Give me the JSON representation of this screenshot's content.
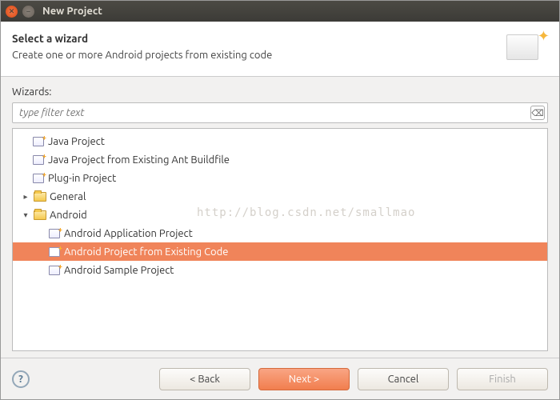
{
  "titlebar": {
    "title": "New Project"
  },
  "header": {
    "heading": "Select a wizard",
    "description": "Create one or more Android projects from existing code"
  },
  "body": {
    "wizards_label": "Wizards:",
    "filter_placeholder": "type filter text"
  },
  "tree": {
    "items": [
      {
        "indent": 0,
        "arrow": "",
        "icon": "proj",
        "label": "Java Project",
        "selected": false
      },
      {
        "indent": 0,
        "arrow": "",
        "icon": "proj",
        "label": "Java Project from Existing Ant Buildfile",
        "selected": false
      },
      {
        "indent": 0,
        "arrow": "",
        "icon": "proj",
        "label": "Plug-in Project",
        "selected": false
      },
      {
        "indent": 0,
        "arrow": "▸",
        "icon": "folder",
        "label": "General",
        "selected": false
      },
      {
        "indent": 0,
        "arrow": "▾",
        "icon": "folder",
        "label": "Android",
        "selected": false
      },
      {
        "indent": 1,
        "arrow": "",
        "icon": "proj",
        "label": "Android Application Project",
        "selected": false
      },
      {
        "indent": 1,
        "arrow": "",
        "icon": "proj",
        "label": "Android Project from Existing Code",
        "selected": true
      },
      {
        "indent": 1,
        "arrow": "",
        "icon": "proj",
        "label": "Android Sample Project",
        "selected": false
      }
    ]
  },
  "footer": {
    "back": "< Back",
    "next": "Next >",
    "cancel": "Cancel",
    "finish": "Finish"
  },
  "watermark": "http://blog.csdn.net/smallmao"
}
